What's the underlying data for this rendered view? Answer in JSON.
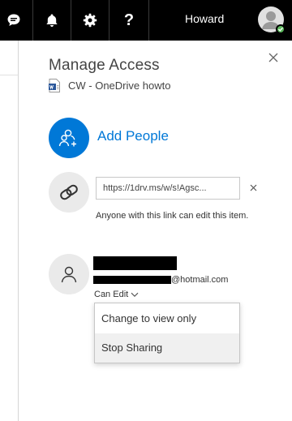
{
  "topbar": {
    "user_name": "Howard",
    "icons": [
      "chat-icon",
      "bell-icon",
      "gear-icon",
      "help-icon",
      "user-avatar"
    ],
    "help_glyph": "?",
    "colors": {
      "background": "#000000",
      "text": "#ffffff",
      "status": "#5cb85c"
    }
  },
  "panel": {
    "title": "Manage Access",
    "document": {
      "name": "CW - OneDrive howto",
      "icon": "word-doc-icon"
    },
    "add_people": {
      "label": "Add People",
      "accent": "#0078d7"
    },
    "link": {
      "url": "https://1drv.ms/w/s!Agsc...",
      "description": "Anyone with this link can edit this item."
    },
    "person": {
      "email_suffix": "@hotmail.com",
      "permission_label": "Can Edit",
      "menu": {
        "items": [
          "Change to view only",
          "Stop Sharing"
        ],
        "highlighted": "Stop Sharing"
      }
    }
  }
}
